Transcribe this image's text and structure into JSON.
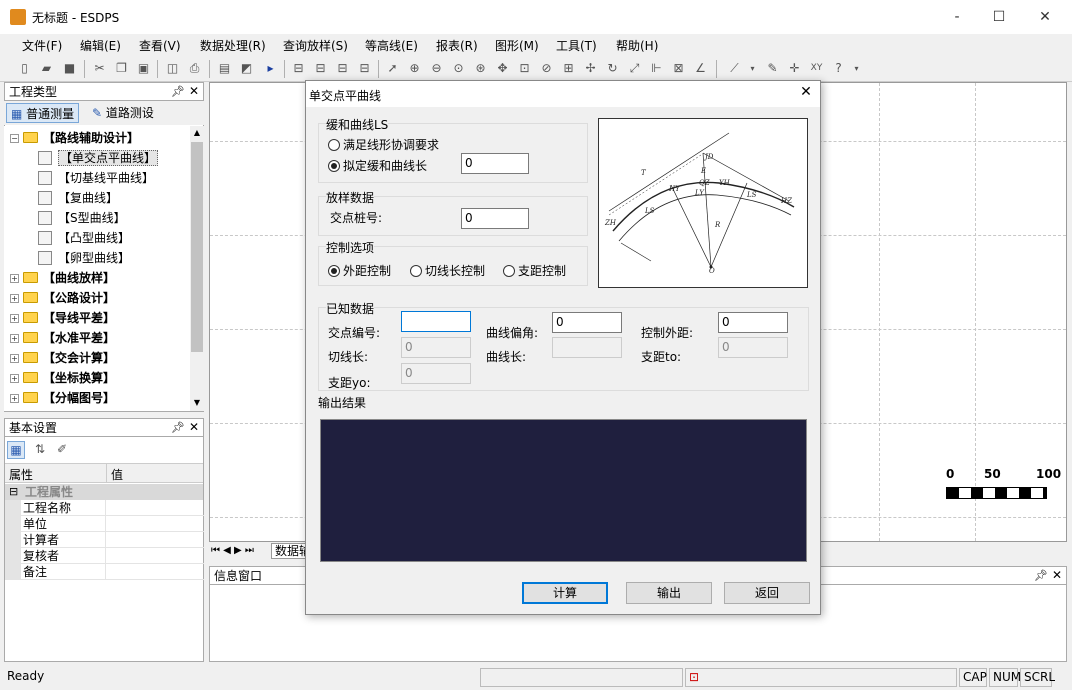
{
  "window": {
    "title": "无标题 - ESDPS",
    "minimize": "-",
    "maximize": "☐",
    "close": "✕"
  },
  "menu": [
    "文件(F)",
    "编辑(E)",
    "查看(V)",
    "数据处理(R)",
    "查询放样(S)",
    "等高线(E)",
    "报表(R)",
    "图形(M)",
    "工具(T)",
    "帮助(H)"
  ],
  "project_panel": {
    "title": "工程类型",
    "tabs": [
      "普通测量",
      "道路测设"
    ],
    "tree": [
      {
        "label": "【路线辅助设计】",
        "level": 0,
        "kind": "folder",
        "expanded": true
      },
      {
        "label": "【单交点平曲线】",
        "level": 1,
        "kind": "doc",
        "selected": true
      },
      {
        "label": "【切基线平曲线】",
        "level": 1,
        "kind": "doc"
      },
      {
        "label": "【复曲线】",
        "level": 1,
        "kind": "doc"
      },
      {
        "label": "【S型曲线】",
        "level": 1,
        "kind": "doc"
      },
      {
        "label": "【凸型曲线】",
        "level": 1,
        "kind": "doc"
      },
      {
        "label": "【卵型曲线】",
        "level": 1,
        "kind": "doc"
      },
      {
        "label": "【曲线放样】",
        "level": 0,
        "kind": "folder"
      },
      {
        "label": "【公路设计】",
        "level": 0,
        "kind": "folder"
      },
      {
        "label": "【导线平差】",
        "level": 0,
        "kind": "folder"
      },
      {
        "label": "【水准平差】",
        "level": 0,
        "kind": "folder"
      },
      {
        "label": "【交会计算】",
        "level": 0,
        "kind": "folder"
      },
      {
        "label": "【坐标换算】",
        "level": 0,
        "kind": "folder"
      },
      {
        "label": "【分幅图号】",
        "level": 0,
        "kind": "folder"
      }
    ]
  },
  "basic_panel": {
    "title": "基本设置",
    "col_key": "属性",
    "col_val": "值",
    "section": "工程属性",
    "rows": [
      "工程名称",
      "单位",
      "计算者",
      "复核者",
      "备注"
    ]
  },
  "canvas": {
    "scale_labels": [
      "0",
      "50",
      "100"
    ],
    "sheet_tab": "数据输"
  },
  "info_panel": {
    "title": "信息窗口"
  },
  "status": {
    "left": "Ready",
    "cap": "CAP",
    "num": "NUM",
    "scrl": "SCRL"
  },
  "dialog": {
    "title": "单交点平曲线",
    "close": "✕",
    "ls_group": {
      "title": "缓和曲线LS",
      "opt1": "满足线形协调要求",
      "opt2": "拟定缓和曲线长",
      "value": "0"
    },
    "stake_group": {
      "title": "放样数据",
      "label": "交点桩号:",
      "value": "0"
    },
    "control_group": {
      "title": "控制选项",
      "opts": [
        "外距控制",
        "切线长控制",
        "支距控制"
      ]
    },
    "known_group": {
      "title": "已知数据",
      "jd_label": "交点编号:",
      "jd_value": "",
      "angle_label": "曲线偏角:",
      "angle_value": "0",
      "ext_label": "控制外距:",
      "ext_value": "0",
      "tangent_label": "切线长:",
      "tangent_value": "0",
      "curve_label": "曲线长:",
      "curve_value": "",
      "to_label": "支距to:",
      "to_value": "0",
      "yo_label": "支距yo:",
      "yo_value": "0"
    },
    "output_title": "输出结果",
    "buttons": {
      "calc": "计算",
      "export": "输出",
      "back": "返回"
    },
    "diagram_labels": [
      "ZH",
      "HY",
      "QZ",
      "YH",
      "HZ",
      "LS",
      "LS",
      "LY",
      "JD",
      "T",
      "E",
      "R",
      "O"
    ]
  }
}
